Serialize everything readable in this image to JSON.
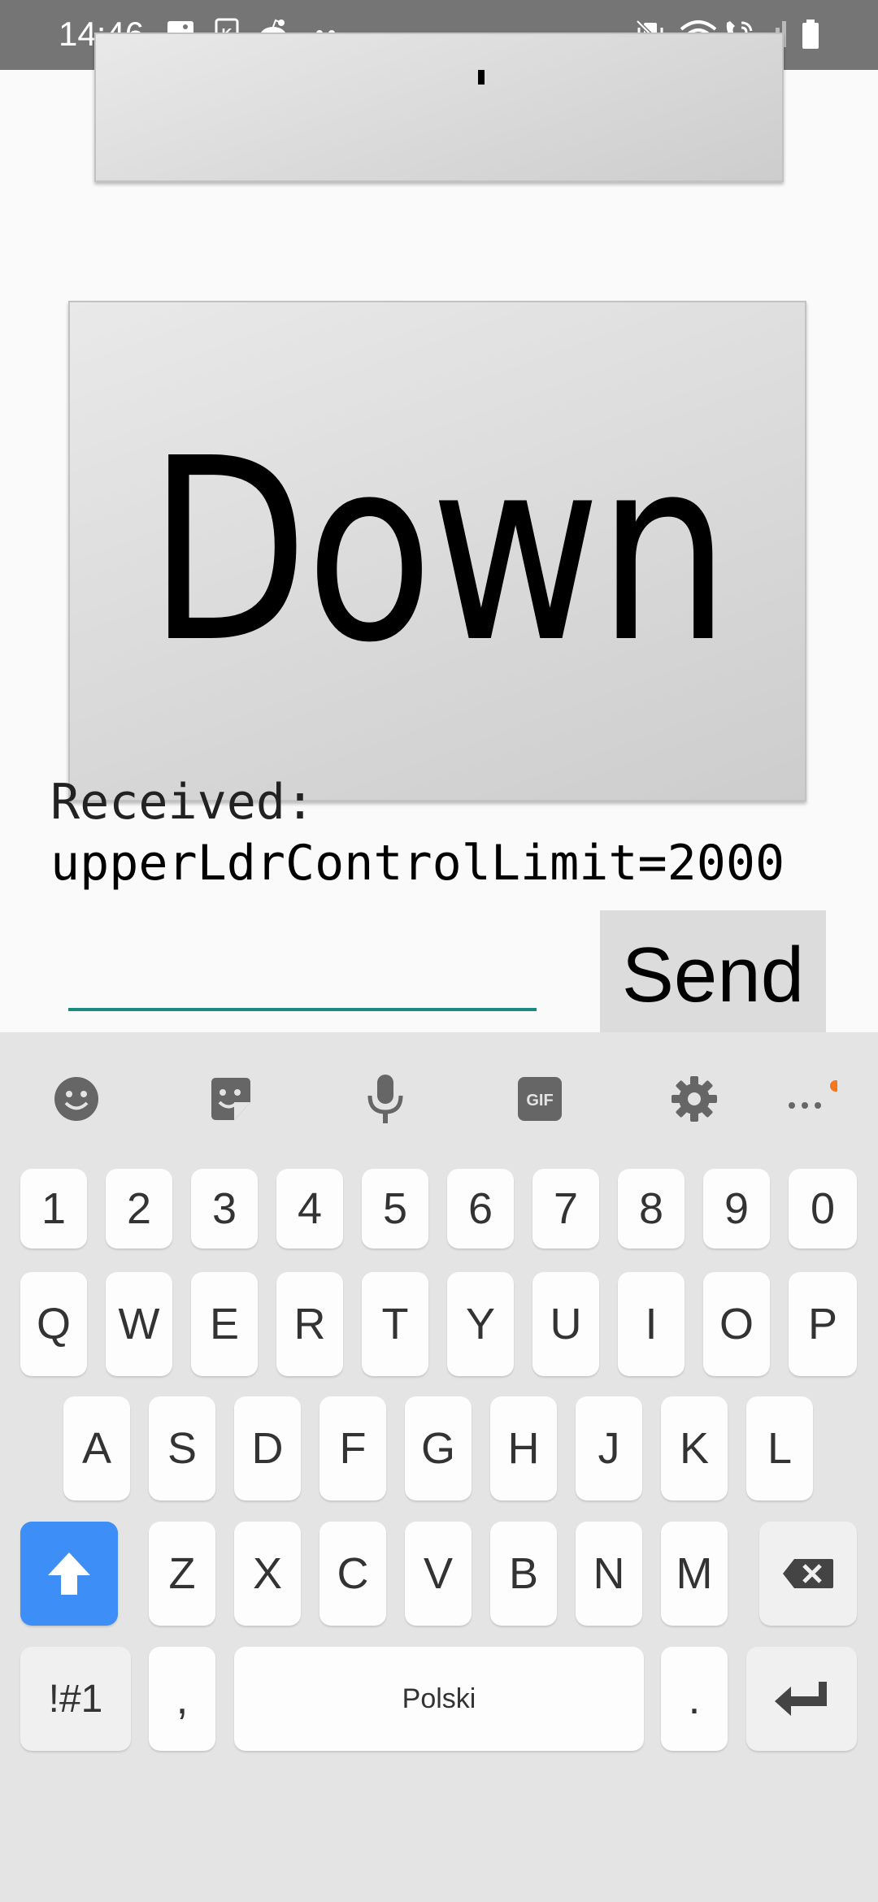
{
  "status_bar": {
    "time": "14:46",
    "left_icons": [
      "image-icon",
      "k-app-icon",
      "reddit-icon",
      "more-dots-icon"
    ],
    "right_icons": [
      "vibrate-icon",
      "wifi-icon",
      "wifi-call-icon",
      "signal-icon",
      "battery-icon"
    ]
  },
  "app": {
    "down_button_label": "Down",
    "received_line1": "Received:",
    "received_line2": "upperLdrControlLimit=2000",
    "input_value": "",
    "send_button_label": "Send"
  },
  "keyboard": {
    "toolbar": [
      "emoji-icon",
      "sticker-icon",
      "mic-icon",
      "gif-icon",
      "settings-icon",
      "more-icon"
    ],
    "gif_label": "GIF",
    "row_numbers": [
      "1",
      "2",
      "3",
      "4",
      "5",
      "6",
      "7",
      "8",
      "9",
      "0"
    ],
    "row1": [
      "Q",
      "W",
      "E",
      "R",
      "T",
      "Y",
      "U",
      "I",
      "O",
      "P"
    ],
    "row2": [
      "A",
      "S",
      "D",
      "F",
      "G",
      "H",
      "J",
      "K",
      "L"
    ],
    "row3": [
      "Z",
      "X",
      "C",
      "V",
      "B",
      "N",
      "M"
    ],
    "symbols_label": "!#1",
    "comma_label": ",",
    "space_label": "Polski",
    "period_label": "."
  },
  "colors": {
    "status_bar": "#757575",
    "input_underline": "#1a8a80",
    "shift_key": "#3d8ef7",
    "notification_dot": "#f4761e"
  }
}
